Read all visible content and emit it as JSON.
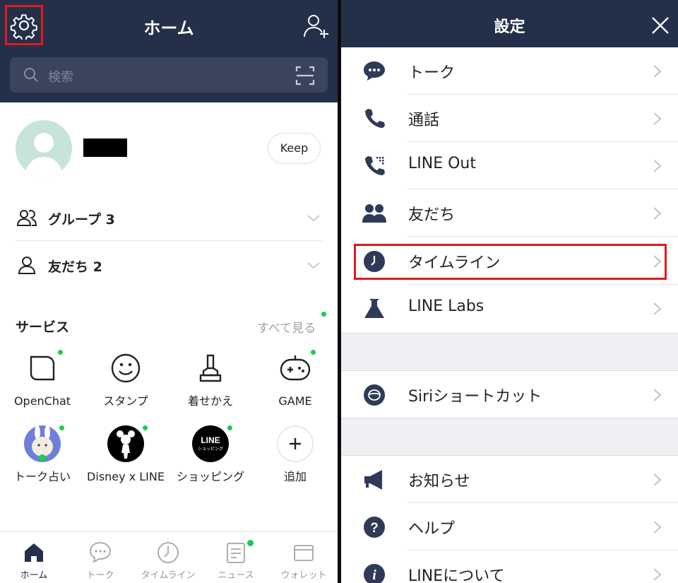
{
  "home": {
    "title": "ホーム",
    "search": {
      "placeholder": "検索"
    },
    "keep_label": "Keep",
    "list": [
      {
        "label": "グループ 3",
        "icon": "group-icon"
      },
      {
        "label": "友だち 2",
        "icon": "person-icon"
      }
    ],
    "services": {
      "title": "サービス",
      "see_all": "すべて見る",
      "items": [
        {
          "label": "OpenChat",
          "icon": "openchat-icon",
          "badge": true
        },
        {
          "label": "スタンプ",
          "icon": "smile-icon",
          "badge": false
        },
        {
          "label": "着せかえ",
          "icon": "brush-icon",
          "badge": false
        },
        {
          "label": "GAME",
          "icon": "gamepad-icon",
          "badge": true
        },
        {
          "label": "トーク占い",
          "icon": "fortune-icon",
          "badge": true
        },
        {
          "label": "Disney x LINE",
          "icon": "disney-icon",
          "badge": true
        },
        {
          "label": "ショッピング",
          "icon": "shopping-icon",
          "badge": true,
          "logo_text": [
            "LINE",
            "ショッピング"
          ]
        },
        {
          "label": "追加",
          "icon": "plus-icon",
          "badge": false
        }
      ]
    },
    "nav": [
      {
        "label": "ホーム",
        "icon": "home-icon",
        "active": true
      },
      {
        "label": "トーク",
        "icon": "chat-icon",
        "active": false
      },
      {
        "label": "タイムライン",
        "icon": "clock-icon",
        "active": false
      },
      {
        "label": "ニュース",
        "icon": "news-icon",
        "active": false,
        "badge": true
      },
      {
        "label": "ウォレット",
        "icon": "wallet-icon",
        "active": false
      }
    ]
  },
  "settings": {
    "title": "設定",
    "rows": [
      {
        "label": "トーク",
        "icon": "chat-bubble-icon"
      },
      {
        "label": "通話",
        "icon": "phone-icon"
      },
      {
        "label": "LINE Out",
        "icon": "phone-out-icon"
      },
      {
        "label": "友だち",
        "icon": "friends-icon"
      },
      {
        "label": "タイムライン",
        "icon": "clock-icon"
      },
      {
        "label": "LINE Labs",
        "icon": "flask-icon"
      },
      {
        "label": "Siriショートカット",
        "icon": "siri-icon"
      },
      {
        "label": "お知らせ",
        "icon": "megaphone-icon"
      },
      {
        "label": "ヘルプ",
        "icon": "help-icon"
      },
      {
        "label": "LINEについて",
        "icon": "info-icon"
      }
    ]
  },
  "colors": {
    "navy": "#243049",
    "highlight": "#e0191f",
    "badge": "#1bcb52"
  }
}
